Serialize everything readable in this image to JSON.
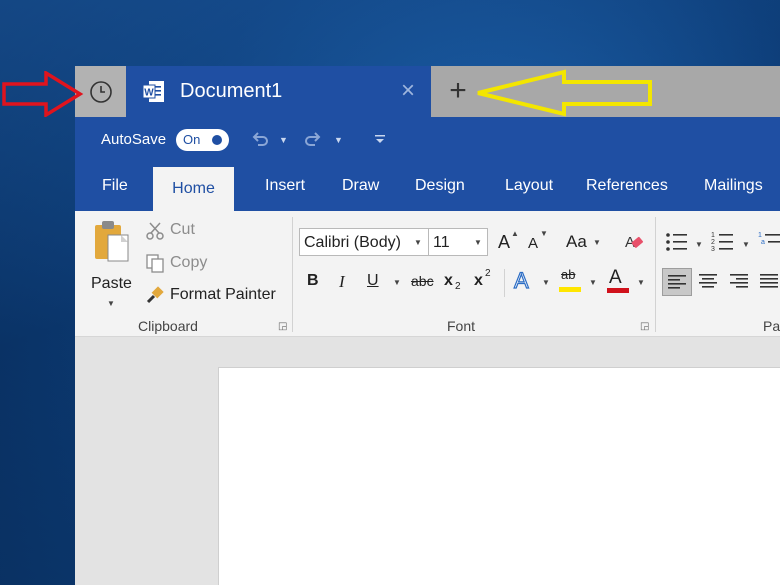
{
  "tab_strip": {
    "document_tab_title": "Document1",
    "close_glyph": "×",
    "new_tab_glyph": "+"
  },
  "quick_access": {
    "autosave_label": "AutoSave",
    "toggle_state": "On"
  },
  "ribbon_tabs": [
    "File",
    "Home",
    "Insert",
    "Draw",
    "Design",
    "Layout",
    "References",
    "Mailings"
  ],
  "clipboard": {
    "paste_label": "Paste",
    "cut_label": "Cut",
    "copy_label": "Copy",
    "format_painter_label": "Format Painter",
    "group_label": "Clipboard"
  },
  "font": {
    "font_name": "Calibri (Body)",
    "font_size": "11",
    "grow_label": "A",
    "shrink_label": "A",
    "case_label": "Aa",
    "bold_label": "B",
    "italic_label": "I",
    "underline_label": "U",
    "strike_label": "abc",
    "subscript_label": "x",
    "subscript_suffix": "2",
    "superscript_label": "x",
    "superscript_suffix": "2",
    "effects_label": "A",
    "highlight_label": "ab",
    "font_color_label": "A",
    "group_label": "Font"
  },
  "paragraph": {
    "group_label_partial": "Pa"
  },
  "colors": {
    "accent": "#1f4fa3",
    "annotation_red": "#e0141e",
    "annotation_yellow": "#f3e600",
    "highlight_yellow": "#ffe600",
    "font_color_red": "#d0111b"
  }
}
